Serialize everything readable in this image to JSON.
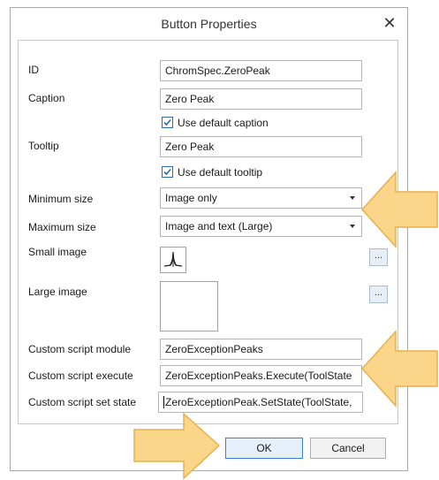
{
  "dialog": {
    "title": "Button Properties",
    "close_glyph": "✕"
  },
  "fields": {
    "id": {
      "label": "ID",
      "value": "ChromSpec.ZeroPeak"
    },
    "caption": {
      "label": "Caption",
      "value": "Zero Peak"
    },
    "use_default_caption": {
      "label": "Use default caption",
      "checked": true
    },
    "tooltip": {
      "label": "Tooltip",
      "value": "Zero Peak"
    },
    "use_default_tooltip": {
      "label": "Use default tooltip",
      "checked": true
    },
    "minimum_size": {
      "label": "Minimum size",
      "value": "Image only"
    },
    "maximum_size": {
      "label": "Maximum size",
      "value": "Image and text (Large)"
    },
    "small_image": {
      "label": "Small image",
      "icon": "peak-icon"
    },
    "large_image": {
      "label": "Large image"
    },
    "browse_label": "...",
    "script_module": {
      "label": "Custom script module",
      "value": "ZeroExceptionPeaks"
    },
    "script_execute": {
      "label": "Custom script execute",
      "value": "ZeroExceptionPeaks.Execute(ToolState"
    },
    "script_set_state": {
      "label": "Custom script set state",
      "value": "ZeroExceptionPeak.SetState(ToolState,"
    }
  },
  "buttons": {
    "ok": "OK",
    "cancel": "Cancel"
  },
  "annotations": {
    "arrow_color": "#fbd58a",
    "arrow_stroke": "#e8b04a"
  }
}
